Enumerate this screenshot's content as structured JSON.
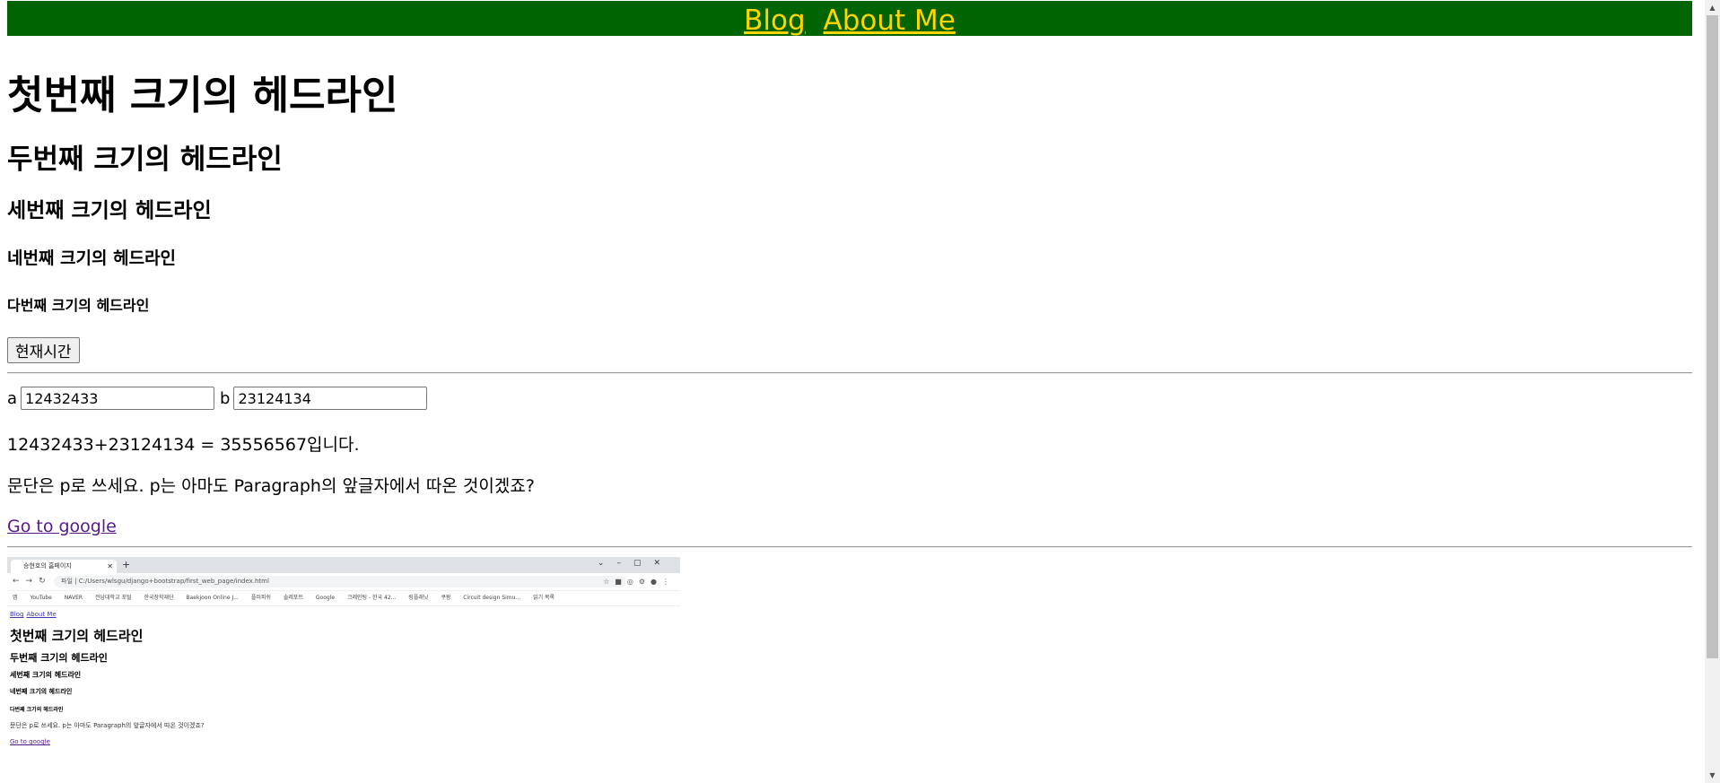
{
  "nav": {
    "blog": "Blog",
    "about": "About Me"
  },
  "headings": {
    "h1": "첫번째 크기의 헤드라인",
    "h2": "두번째 크기의 헤드라인",
    "h3": "세번째 크기의 헤드라인",
    "h4": "네번째 크기의 헤드라인",
    "h5": "다번째 크기의 헤드라인"
  },
  "time_button": "현재시간",
  "calc": {
    "a_label": "a",
    "a_value": "12432433",
    "b_label": "b",
    "b_value": "23124134"
  },
  "result": "12432433+23124134 = 35556567입니다.",
  "paragraph": "문단은 p로 쓰세요. p는 아마도 Paragraph의 앞글자에서 따온 것이겠죠?",
  "google_link": "Go to google",
  "screenshot": {
    "tab_title": "승현호의 홈페이지",
    "url": "파일 | C:/Users/wlsgu/django+bootstrap/first_web_page/index.html",
    "bookmarks": [
      "앱",
      "YouTube",
      "NAVER",
      "전남대학교 포털",
      "한국장학재단",
      "Baekjoon Online J...",
      "플러피쉬",
      "솔레포트",
      "Google",
      "크레인팅 - 한국 42...",
      "링플래닛",
      "쿠팡",
      "Circuit design Simu...",
      "읽기 목록"
    ],
    "nav_blog": "Blog",
    "nav_about": "About Me",
    "h1": "첫번째 크기의 헤드라인",
    "h2": "두번째 크기의 헤드라인",
    "h3": "세번째 크기의 헤드라인",
    "h4": "네번째 크기의 헤드라인",
    "h5": "다번째 크기의 헤드라인",
    "paragraph": "문단은 p로 쓰세요. p는 아마도 Paragraph의 앞글자에서 따온 것이겠죠?",
    "google_link": "Go to google"
  },
  "colors": {
    "navbar_bg": "#006400",
    "nav_link": "#ffd400",
    "visited_link": "#551a8b"
  }
}
